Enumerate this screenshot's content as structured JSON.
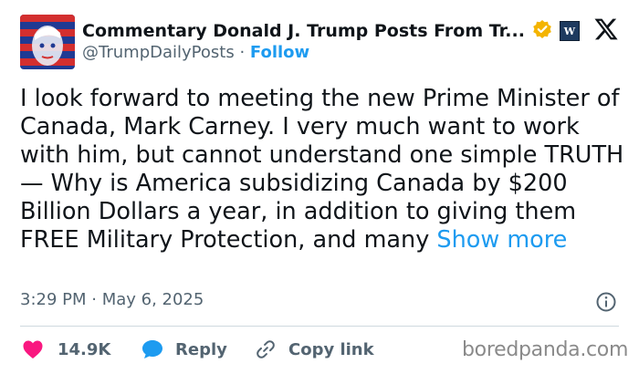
{
  "tweet": {
    "display_name": "Commentary Donald J. Trump Posts From Tr...",
    "handle": "@TrumpDailyPosts",
    "separator": "·",
    "follow_label": "Follow",
    "body": "I look forward to meeting the new Prime Minister of Canada, Mark Carney. I very much want to work with him, but cannot understand one simple TRUTH — Why is America subsidizing Canada by $200 Billion Dollars a year, in addition to giving them FREE Military Protection, and many ",
    "show_more_label": "Show more",
    "timestamp": "3:29 PM · May 6, 2025",
    "badge_letter": "W",
    "verified_color": "#f4b400"
  },
  "actions": {
    "like_count": "14.9K",
    "reply_label": "Reply",
    "copy_link_label": "Copy link"
  },
  "watermark": {
    "text": "boredpanda.com"
  },
  "colors": {
    "like": "#f91880",
    "reply": "#1d9bf0",
    "link": "#1d9bf0",
    "muted": "#536471"
  },
  "icons": [
    "avatar-image",
    "verified-badge-icon",
    "brand-badge-icon",
    "x-logo-icon",
    "info-icon",
    "heart-icon",
    "reply-icon",
    "link-icon"
  ]
}
